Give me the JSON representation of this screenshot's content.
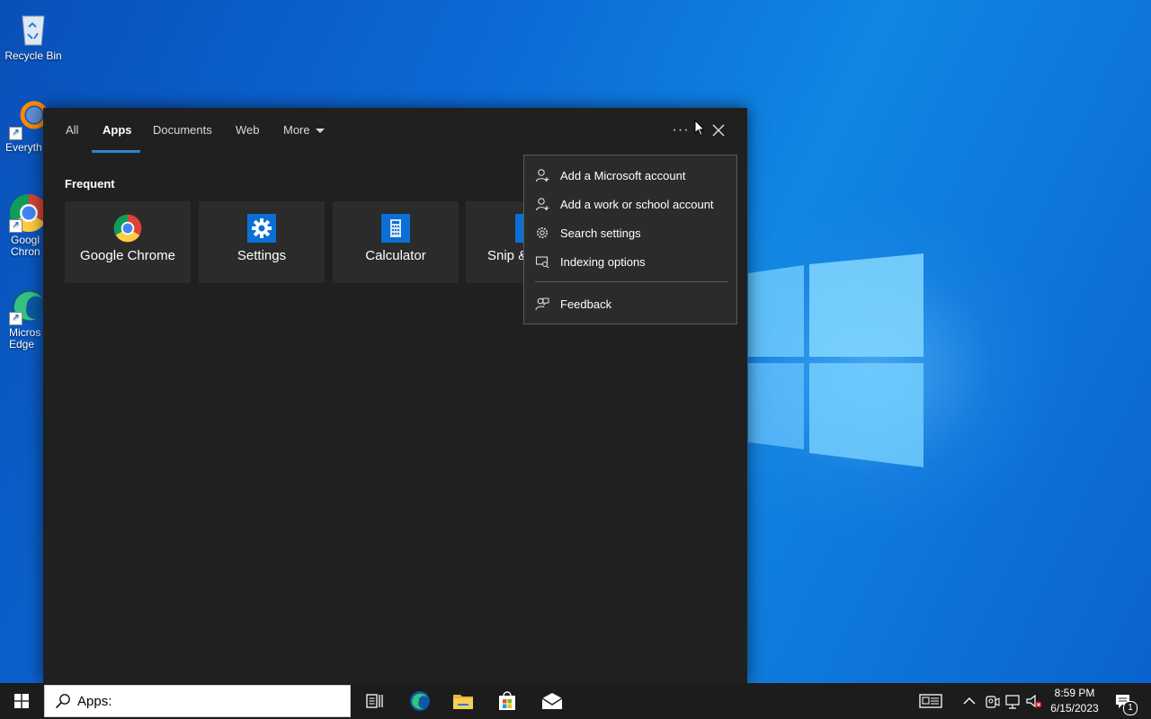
{
  "desktop": {
    "icons": [
      {
        "label": "Recycle Bin"
      },
      {
        "label": "Everyth"
      },
      {
        "label": "Googl\nChron"
      },
      {
        "label": "Micros\nEdge"
      }
    ]
  },
  "search_panel": {
    "tabs": [
      {
        "label": "All"
      },
      {
        "label": "Apps"
      },
      {
        "label": "Documents"
      },
      {
        "label": "Web"
      },
      {
        "label": "More"
      }
    ],
    "active_tab": "Apps",
    "frequent_title": "Frequent",
    "apps": [
      {
        "label": "Google Chrome",
        "icon": "chrome-icon"
      },
      {
        "label": "Settings",
        "icon": "gear-icon"
      },
      {
        "label": "Calculator",
        "icon": "calculator-icon"
      },
      {
        "label": "Snip &",
        "icon": "snip-icon"
      }
    ],
    "more_options_glyph": "···",
    "close_glyph": "✕"
  },
  "context_menu": {
    "items": [
      {
        "label": "Add a Microsoft account",
        "icon": "person-add-icon"
      },
      {
        "label": "Add a work or school account",
        "icon": "person-add-icon"
      },
      {
        "label": "Search settings",
        "icon": "gear-icon"
      },
      {
        "label": "Indexing options",
        "icon": "indexing-icon"
      },
      {
        "label": "Feedback",
        "icon": "feedback-icon"
      }
    ]
  },
  "taskbar": {
    "search_value": "Apps:",
    "clock_time": "8:59 PM",
    "clock_date": "6/15/2023",
    "notification_count": "1"
  },
  "colors": {
    "accent": "#2f84d8",
    "panel_bg": "#202020",
    "tile_bg": "#2b2b2b",
    "taskbar_bg": "#1c1c1c"
  }
}
